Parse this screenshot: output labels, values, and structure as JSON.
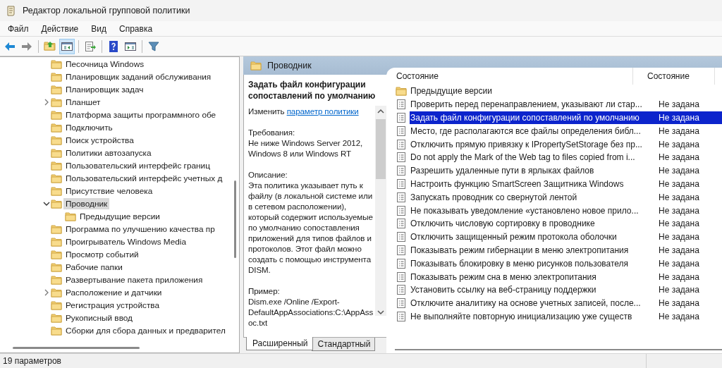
{
  "window": {
    "title": "Редактор локальной групповой политики"
  },
  "menu": [
    "Файл",
    "Действие",
    "Вид",
    "Справка"
  ],
  "toolbar": [
    {
      "kind": "back",
      "pressed": false
    },
    {
      "kind": "forward",
      "pressed": false
    },
    {
      "kind": "sep"
    },
    {
      "kind": "up",
      "pressed": false
    },
    {
      "kind": "tree",
      "pressed": true
    },
    {
      "kind": "sep"
    },
    {
      "kind": "export",
      "pressed": false
    },
    {
      "kind": "sep"
    },
    {
      "kind": "help",
      "pressed": false
    },
    {
      "kind": "pane",
      "pressed": false
    },
    {
      "kind": "sep"
    },
    {
      "kind": "filter",
      "pressed": false
    }
  ],
  "tree": [
    {
      "label": "Песочница Windows",
      "expandable": false,
      "selected": false
    },
    {
      "label": "Планировщик заданий обслуживания",
      "expandable": false,
      "selected": false
    },
    {
      "label": "Планировщик задач",
      "expandable": false,
      "selected": false
    },
    {
      "label": "Планшет",
      "expandable": true,
      "expanded": false,
      "selected": false
    },
    {
      "label": "Платформа защиты программного обе",
      "expandable": false,
      "selected": false
    },
    {
      "label": "Подключить",
      "expandable": false,
      "selected": false
    },
    {
      "label": "Поиск устройства",
      "expandable": false,
      "selected": false
    },
    {
      "label": "Политики автозапуска",
      "expandable": false,
      "selected": false
    },
    {
      "label": "Пользовательский интерфейс границ",
      "expandable": false,
      "selected": false
    },
    {
      "label": "Пользовательский интерфейс учетных д",
      "expandable": false,
      "selected": false
    },
    {
      "label": "Присутствие человека",
      "expandable": false,
      "selected": false
    },
    {
      "label": "Проводник",
      "expandable": true,
      "expanded": true,
      "selected": true,
      "children": [
        {
          "label": "Предыдущие версии",
          "expandable": false,
          "selected": false
        }
      ]
    },
    {
      "label": "Программа по улучшению качества пр",
      "expandable": false,
      "selected": false
    },
    {
      "label": "Проигрыватель Windows Media",
      "expandable": false,
      "selected": false
    },
    {
      "label": "Просмотр событий",
      "expandable": false,
      "selected": false
    },
    {
      "label": "Рабочие папки",
      "expandable": false,
      "selected": false
    },
    {
      "label": "Развертывание пакета приложения",
      "expandable": false,
      "selected": false
    },
    {
      "label": "Расположение и датчики",
      "expandable": true,
      "expanded": false,
      "selected": false
    },
    {
      "label": "Регистрация устройства",
      "expandable": false,
      "selected": false
    },
    {
      "label": "Рукописный ввод",
      "expandable": false,
      "selected": false
    },
    {
      "label": "Сборки для сбора данных и предварител",
      "expandable": false,
      "selected": false
    }
  ],
  "details": {
    "header": "Проводник",
    "title": "Задать файл конфигурации сопоставлений по умолчанию",
    "edit_prefix": "Изменить",
    "edit_link": "параметр политики",
    "requirements_label": "Требования:",
    "requirements": "Не ниже Windows Server 2012, Windows 8 или Windows RT",
    "description_label": "Описание:",
    "description": "Эта политика указывает путь к файлу (в локальной системе или в сетевом расположении), который содержит используемые по умолчанию сопоставления приложений для типов файлов и протоколов. Этот файл можно создать с помощью инструмента DISM.",
    "example_label": "Пример:",
    "example": "Dism.exe /Online /Export-DefaultAppAssociations:C:\\AppAssoc.txt"
  },
  "view_tabs": [
    {
      "label": "Расширенный",
      "selected": true
    },
    {
      "label": "Стандартный",
      "selected": false
    }
  ],
  "table": {
    "columns": [
      "Состояние",
      "Состояние"
    ],
    "rows": [
      {
        "kind": "folder",
        "name": "Предыдущие версии",
        "selected": false
      },
      {
        "kind": "setting",
        "name": "Проверить перед перенаправлением, указывают ли стар...",
        "state": "Не задана",
        "selected": false
      },
      {
        "kind": "setting",
        "name": "Задать файл конфигурации сопоставлений по умолчанию",
        "state": "Не задана",
        "selected": true
      },
      {
        "kind": "setting",
        "name": "Место, где располагаются все файлы определения библ...",
        "state": "Не задана",
        "selected": false
      },
      {
        "kind": "setting",
        "name": "Отключить прямую привязку к IPropertySetStorage без пр...",
        "state": "Не задана",
        "selected": false
      },
      {
        "kind": "setting",
        "name": "Do not apply the Mark of the Web tag to files copied from i...",
        "state": "Не задана",
        "selected": false
      },
      {
        "kind": "setting",
        "name": "Разрешить удаленные пути в ярлыках файлов",
        "state": "Не задана",
        "selected": false
      },
      {
        "kind": "setting",
        "name": "Настроить функцию SmartScreen Защитника Windows",
        "state": "Не задана",
        "selected": false
      },
      {
        "kind": "setting",
        "name": "Запускать проводник со свернутой лентой",
        "state": "Не задана",
        "selected": false
      },
      {
        "kind": "setting",
        "name": "Не показывать уведомление «установлено новое прило...",
        "state": "Не задана",
        "selected": false
      },
      {
        "kind": "setting",
        "name": "Отключить числовую сортировку в проводнике",
        "state": "Не задана",
        "selected": false
      },
      {
        "kind": "setting",
        "name": "Отключить защищенный режим протокола оболочки",
        "state": "Не задана",
        "selected": false
      },
      {
        "kind": "setting",
        "name": "Показывать режим гибернации в меню электропитания",
        "state": "Не задана",
        "selected": false
      },
      {
        "kind": "setting",
        "name": "Показывать блокировку в меню рисунков пользователя",
        "state": "Не задана",
        "selected": false
      },
      {
        "kind": "setting",
        "name": "Показывать режим сна в меню электропитания",
        "state": "Не задана",
        "selected": false
      },
      {
        "kind": "setting",
        "name": "Установить ссылку на веб-страницу поддержки",
        "state": "Не задана",
        "selected": false
      },
      {
        "kind": "setting",
        "name": "Отключите аналитику на основе учетных записей, после...",
        "state": "Не задана",
        "selected": false
      },
      {
        "kind": "setting",
        "name": "Не выполняйте повторную инициализацию уже существ",
        "state": "Не задана",
        "selected": false
      }
    ]
  },
  "status_bar": "19 параметров"
}
